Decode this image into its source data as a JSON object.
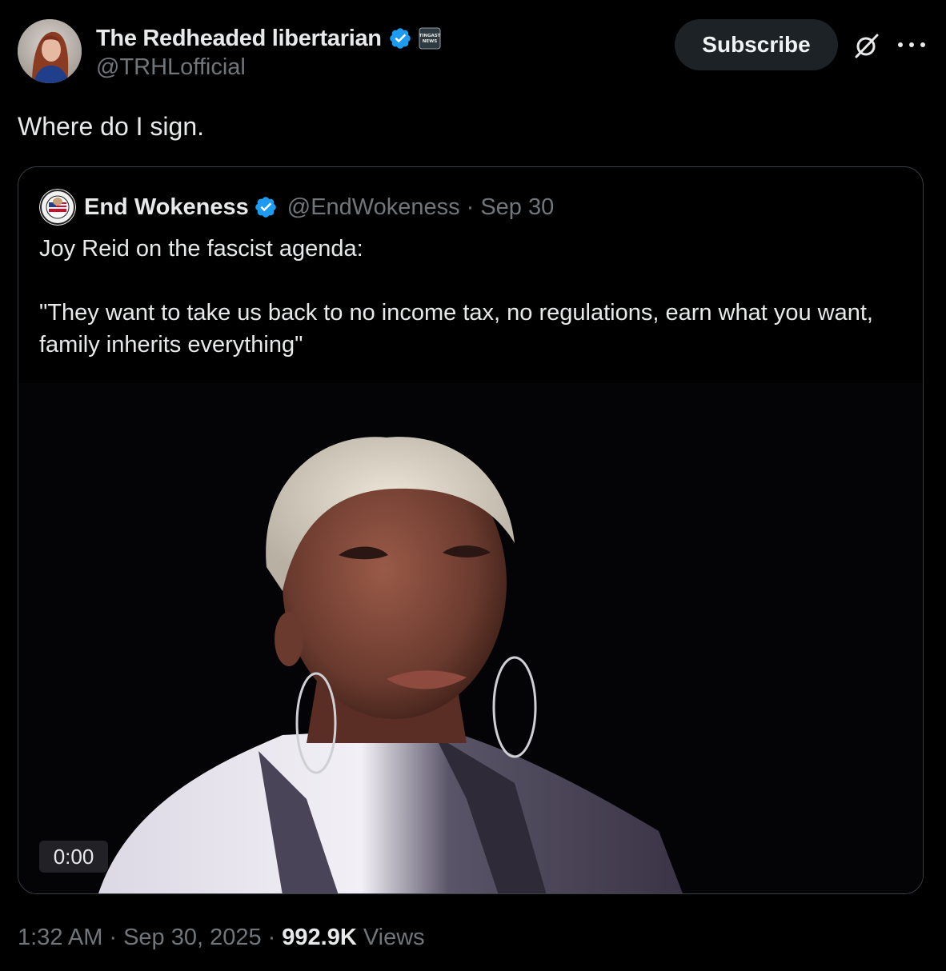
{
  "post": {
    "author": {
      "display_name": "The Redheaded libertarian",
      "handle": "@TRHLofficial",
      "affiliate_badge_text": "TINGAST NEWS"
    },
    "subscribe_label": "Subscribe",
    "text": "Where do I sign.",
    "time": "1:32 AM",
    "date": "Sep 30, 2025",
    "separator": "·",
    "views_count": "992.9K",
    "views_label": "Views"
  },
  "quote": {
    "author": {
      "display_name": "End Wokeness",
      "handle": "@EndWokeness",
      "date": "Sep 30"
    },
    "separator": "·",
    "text_line1": "Joy Reid on the fascist agenda:",
    "text_line2": "\"They want to take us back to no income tax, no regulations, earn what you want, family inherits everything\"",
    "video_time": "0:00"
  },
  "colors": {
    "background": "#000000",
    "text_primary": "#e7e9ea",
    "text_secondary": "#71767b",
    "verified_blue": "#1d9bf0",
    "card_border": "#3a3f44",
    "subscribe_bg": "#1d2226"
  },
  "icons": {
    "verified": "verified-check-icon",
    "grok": "grok-icon",
    "more": "more-options-icon"
  }
}
